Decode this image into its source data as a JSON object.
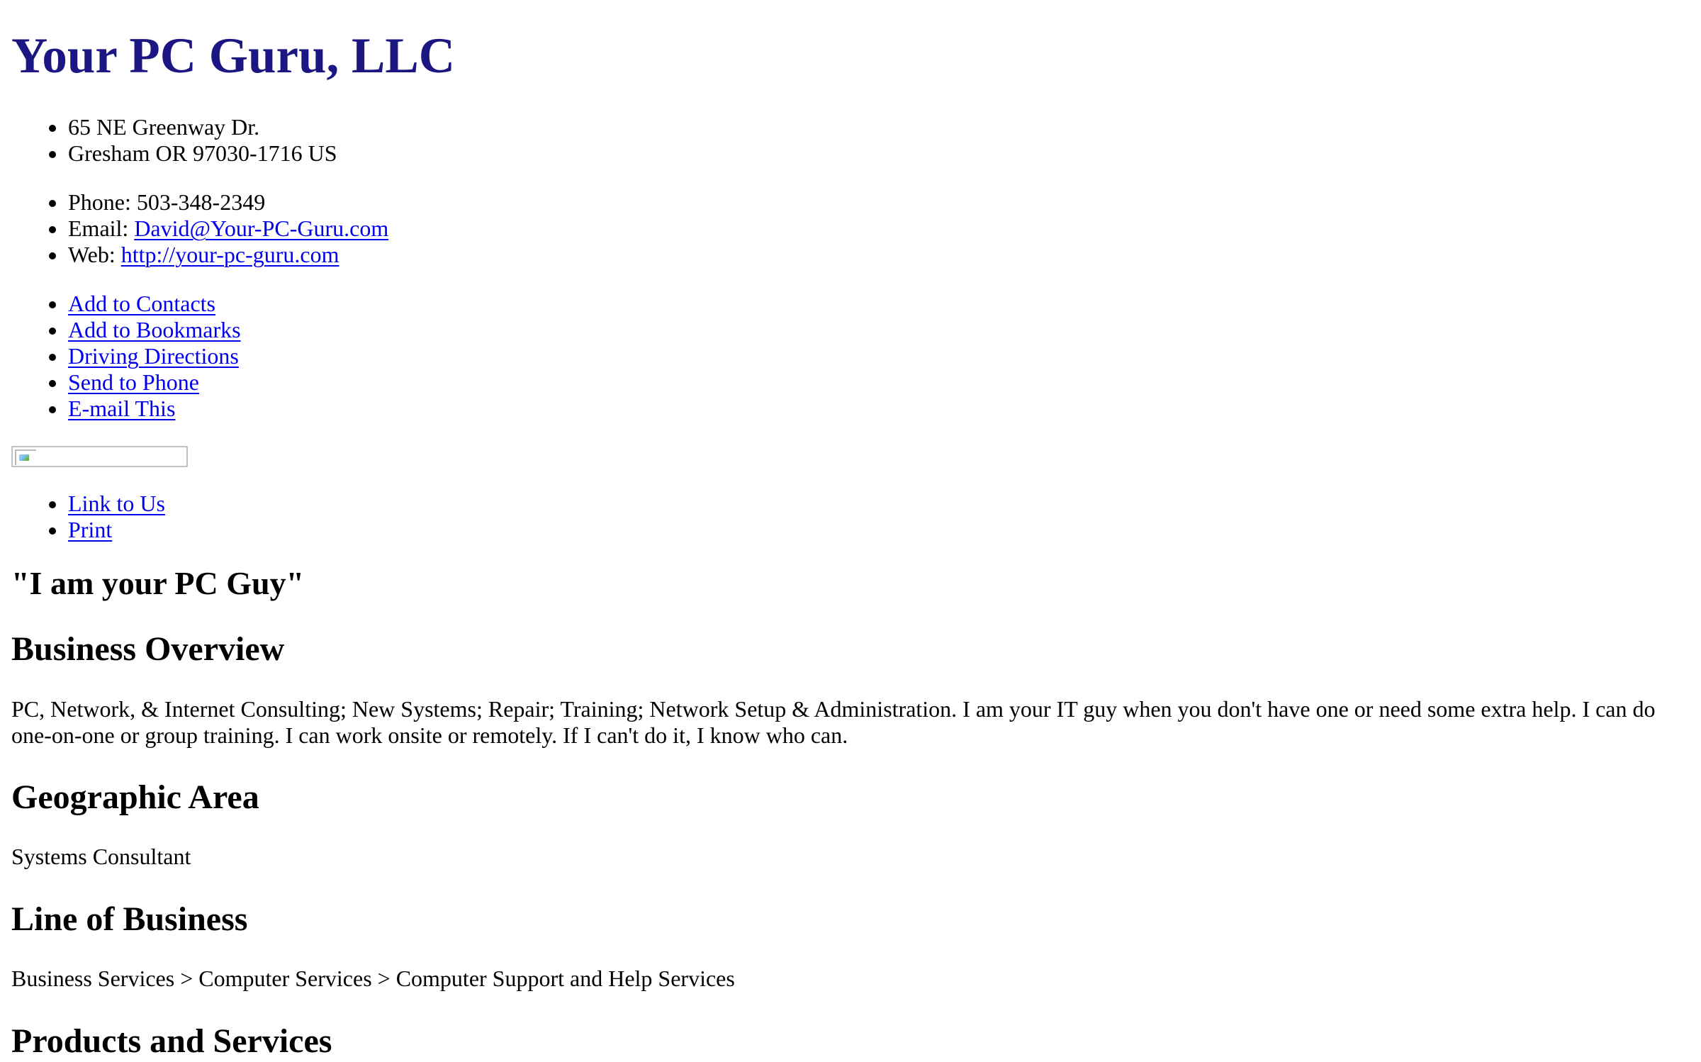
{
  "company": {
    "name": "Your PC Guru, LLC"
  },
  "address": {
    "street": "65 NE Greenway Dr.",
    "city_line": "Gresham OR 97030-1716 US"
  },
  "contact": {
    "phone_label": "Phone: ",
    "phone": "503-348-2349",
    "email_label": "Email: ",
    "email": "David@Your-PC-Guru.com",
    "web_label": "Web: ",
    "web": "http://your-pc-guru.com"
  },
  "actions": [
    {
      "label": "Add to Contacts"
    },
    {
      "label": "Add to Bookmarks"
    },
    {
      "label": "Driving Directions"
    },
    {
      "label": "Send to Phone"
    },
    {
      "label": "E-mail This"
    }
  ],
  "extra_links": [
    {
      "label": "Link to Us"
    },
    {
      "label": "Print"
    }
  ],
  "slogan": "\"I am your PC Guy\"",
  "sections": {
    "overview": {
      "heading": "Business Overview",
      "text": "PC, Network, & Internet Consulting; New Systems; Repair; Training; Network Setup & Administration. I am your IT guy when you don't have one or need some extra help. I can do one-on-one or group training. I can work onsite or remotely. If I can't do it, I know who can."
    },
    "geographic_area": {
      "heading": "Geographic Area",
      "text": "Systems Consultant"
    },
    "line_of_business": {
      "heading": "Line of Business",
      "text": "Business Services > Computer Services > Computer Support and Help Services"
    },
    "products": {
      "heading": "Products and Services"
    }
  },
  "colors": {
    "title": "#1b1682",
    "link": "#0000ee",
    "text": "#000000",
    "background": "#ffffff"
  }
}
